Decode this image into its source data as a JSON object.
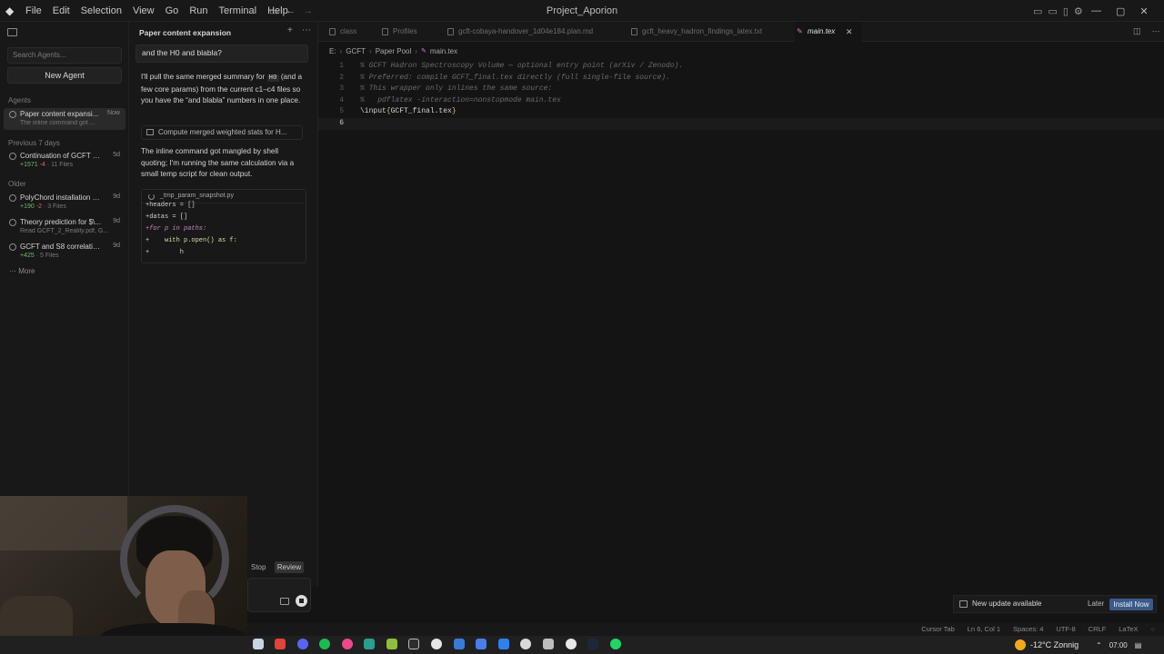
{
  "window": {
    "title": "Project_Aporion",
    "menu": [
      "File",
      "Edit",
      "Selection",
      "View",
      "Go",
      "Run",
      "Terminal",
      "Help"
    ]
  },
  "agents_sidebar": {
    "search_placeholder": "Search Agents...",
    "new_agent_label": "New Agent",
    "section_agents": "Agents",
    "section_previous": "Previous 7 days",
    "section_older": "Older",
    "items": [
      {
        "title": "Paper content expansi...",
        "subtitle": "The inline command got ...",
        "time": "Now",
        "active": true
      },
      {
        "title": "Continuation of GCFT Co...",
        "plus": "+1571",
        "minus": "-4",
        "files": "· 11 Files",
        "time": "5d"
      },
      {
        "title": "PolyChord installation er...",
        "plus": "+190",
        "minus": "-2",
        "files": "· 3 Files",
        "time": "9d"
      },
      {
        "title": "Theory prediction for $\\...",
        "subtitle": "Read GCFT_2_Reality.pdf, G...",
        "time": "9d"
      },
      {
        "title": "GCFT and S8 correlation ...",
        "plus": "+425",
        "files": "· 5 Files",
        "time": "9d"
      }
    ],
    "more_label": "More"
  },
  "chat": {
    "title": "Paper content expansion",
    "user_message": "and the H0 and blabla?",
    "reply_1_pre": "I'll pull the same merged summary for ",
    "reply_1_code": "H0",
    "reply_1_post": " (and a few core params) from the current c1–c4 files so you have the “and blabla” numbers in one place.",
    "tool_call_label": "Compute merged weighted stats for H...",
    "reply_2": "The inline command got mangled by shell quoting; I'm running the same calculation via a small temp script for clean output.",
    "file_name": "_tmp_param_snapshot.py",
    "code_lines": [
      "+headers = []",
      "+datas = []",
      "+for p in paths:",
      "+    with p.open() as f:",
      "+        h"
    ],
    "stop_label": "Stop",
    "review_label": "Review"
  },
  "editor": {
    "tabs": [
      {
        "label": "class"
      },
      {
        "label": "Profiles"
      },
      {
        "label": "gcft-cobaya-handover_1d04e184.plan.md"
      },
      {
        "label": "gcft_heavy_hadron_findings_latex.txt"
      },
      {
        "label": "main.tex",
        "active": true,
        "icon": "TEX"
      }
    ],
    "breadcrumb": [
      "E:",
      "GCFT",
      "Paper Pool",
      "main.tex"
    ],
    "lines": [
      {
        "n": "1",
        "text": "% GCFT Hadron Spectroscopy Volume — optional entry point (arXiv / Zenodo)."
      },
      {
        "n": "2",
        "text": "% Preferred: compile GCFT_final.tex directly (full single-file source)."
      },
      {
        "n": "3",
        "text": "% This wrapper only inlines the same source:"
      },
      {
        "n": "4",
        "text": "%   pdflatex -interaction=nonstopmode main.tex"
      },
      {
        "n": "5",
        "cmd": "\\input",
        "arg": "GCFT_final.tex"
      },
      {
        "n": "6",
        "text": ""
      }
    ]
  },
  "notification": {
    "message": "New update available",
    "later_label": "Later",
    "install_label": "Install Now"
  },
  "statusbar": {
    "items": [
      "Cursor Tab",
      "Ln 6, Col 1",
      "Spaces: 4",
      "UTF-8",
      "CRLF",
      "LaTeX"
    ]
  },
  "taskbar": {
    "weather": "-12°C  Zonnig",
    "time": "07:00"
  },
  "colors": {
    "accent_blue": "#3a5a8a",
    "diff_plus": "#72b96f",
    "diff_minus": "#d96a6a",
    "tex_icon": "#c586c0"
  }
}
